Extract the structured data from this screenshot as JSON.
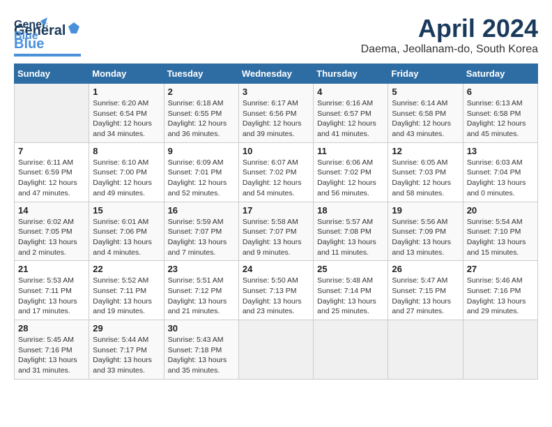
{
  "header": {
    "logo_line1": "General",
    "logo_line2": "Blue",
    "month_title": "April 2024",
    "location": "Daema, Jeollanam-do, South Korea"
  },
  "days_of_week": [
    "Sunday",
    "Monday",
    "Tuesday",
    "Wednesday",
    "Thursday",
    "Friday",
    "Saturday"
  ],
  "weeks": [
    [
      {
        "day": "",
        "info": ""
      },
      {
        "day": "1",
        "info": "Sunrise: 6:20 AM\nSunset: 6:54 PM\nDaylight: 12 hours\nand 34 minutes."
      },
      {
        "day": "2",
        "info": "Sunrise: 6:18 AM\nSunset: 6:55 PM\nDaylight: 12 hours\nand 36 minutes."
      },
      {
        "day": "3",
        "info": "Sunrise: 6:17 AM\nSunset: 6:56 PM\nDaylight: 12 hours\nand 39 minutes."
      },
      {
        "day": "4",
        "info": "Sunrise: 6:16 AM\nSunset: 6:57 PM\nDaylight: 12 hours\nand 41 minutes."
      },
      {
        "day": "5",
        "info": "Sunrise: 6:14 AM\nSunset: 6:58 PM\nDaylight: 12 hours\nand 43 minutes."
      },
      {
        "day": "6",
        "info": "Sunrise: 6:13 AM\nSunset: 6:58 PM\nDaylight: 12 hours\nand 45 minutes."
      }
    ],
    [
      {
        "day": "7",
        "info": "Sunrise: 6:11 AM\nSunset: 6:59 PM\nDaylight: 12 hours\nand 47 minutes."
      },
      {
        "day": "8",
        "info": "Sunrise: 6:10 AM\nSunset: 7:00 PM\nDaylight: 12 hours\nand 49 minutes."
      },
      {
        "day": "9",
        "info": "Sunrise: 6:09 AM\nSunset: 7:01 PM\nDaylight: 12 hours\nand 52 minutes."
      },
      {
        "day": "10",
        "info": "Sunrise: 6:07 AM\nSunset: 7:02 PM\nDaylight: 12 hours\nand 54 minutes."
      },
      {
        "day": "11",
        "info": "Sunrise: 6:06 AM\nSunset: 7:02 PM\nDaylight: 12 hours\nand 56 minutes."
      },
      {
        "day": "12",
        "info": "Sunrise: 6:05 AM\nSunset: 7:03 PM\nDaylight: 12 hours\nand 58 minutes."
      },
      {
        "day": "13",
        "info": "Sunrise: 6:03 AM\nSunset: 7:04 PM\nDaylight: 13 hours\nand 0 minutes."
      }
    ],
    [
      {
        "day": "14",
        "info": "Sunrise: 6:02 AM\nSunset: 7:05 PM\nDaylight: 13 hours\nand 2 minutes."
      },
      {
        "day": "15",
        "info": "Sunrise: 6:01 AM\nSunset: 7:06 PM\nDaylight: 13 hours\nand 4 minutes."
      },
      {
        "day": "16",
        "info": "Sunrise: 5:59 AM\nSunset: 7:07 PM\nDaylight: 13 hours\nand 7 minutes."
      },
      {
        "day": "17",
        "info": "Sunrise: 5:58 AM\nSunset: 7:07 PM\nDaylight: 13 hours\nand 9 minutes."
      },
      {
        "day": "18",
        "info": "Sunrise: 5:57 AM\nSunset: 7:08 PM\nDaylight: 13 hours\nand 11 minutes."
      },
      {
        "day": "19",
        "info": "Sunrise: 5:56 AM\nSunset: 7:09 PM\nDaylight: 13 hours\nand 13 minutes."
      },
      {
        "day": "20",
        "info": "Sunrise: 5:54 AM\nSunset: 7:10 PM\nDaylight: 13 hours\nand 15 minutes."
      }
    ],
    [
      {
        "day": "21",
        "info": "Sunrise: 5:53 AM\nSunset: 7:11 PM\nDaylight: 13 hours\nand 17 minutes."
      },
      {
        "day": "22",
        "info": "Sunrise: 5:52 AM\nSunset: 7:11 PM\nDaylight: 13 hours\nand 19 minutes."
      },
      {
        "day": "23",
        "info": "Sunrise: 5:51 AM\nSunset: 7:12 PM\nDaylight: 13 hours\nand 21 minutes."
      },
      {
        "day": "24",
        "info": "Sunrise: 5:50 AM\nSunset: 7:13 PM\nDaylight: 13 hours\nand 23 minutes."
      },
      {
        "day": "25",
        "info": "Sunrise: 5:48 AM\nSunset: 7:14 PM\nDaylight: 13 hours\nand 25 minutes."
      },
      {
        "day": "26",
        "info": "Sunrise: 5:47 AM\nSunset: 7:15 PM\nDaylight: 13 hours\nand 27 minutes."
      },
      {
        "day": "27",
        "info": "Sunrise: 5:46 AM\nSunset: 7:16 PM\nDaylight: 13 hours\nand 29 minutes."
      }
    ],
    [
      {
        "day": "28",
        "info": "Sunrise: 5:45 AM\nSunset: 7:16 PM\nDaylight: 13 hours\nand 31 minutes."
      },
      {
        "day": "29",
        "info": "Sunrise: 5:44 AM\nSunset: 7:17 PM\nDaylight: 13 hours\nand 33 minutes."
      },
      {
        "day": "30",
        "info": "Sunrise: 5:43 AM\nSunset: 7:18 PM\nDaylight: 13 hours\nand 35 minutes."
      },
      {
        "day": "",
        "info": ""
      },
      {
        "day": "",
        "info": ""
      },
      {
        "day": "",
        "info": ""
      },
      {
        "day": "",
        "info": ""
      }
    ]
  ]
}
